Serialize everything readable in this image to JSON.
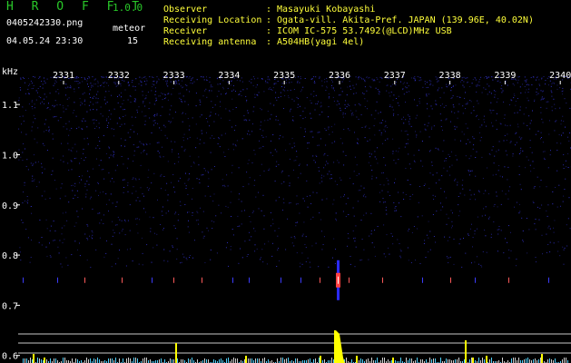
{
  "header": {
    "app_title": "H R O F F T",
    "app_version": "1.0.0",
    "filename": "0405242330.png",
    "datetime": "04.05.24 23:30",
    "meteor_label": "meteor",
    "meteor_count": "15",
    "info": [
      {
        "label": "Observer",
        "sep": ":",
        "value": "Masayuki Kobayashi"
      },
      {
        "label": "Receiving Location",
        "sep": ":",
        "value": "Ogata-vill. Akita-Pref. JAPAN (139.96E, 40.02N)"
      },
      {
        "label": "Receiver",
        "sep": ":",
        "value": "ICOM IC-575 53.7492(@LCD)MHz USB"
      },
      {
        "label": "Receiving antenna",
        "sep": ":",
        "value": "A504HB(yagi 4el)"
      }
    ]
  },
  "chart_data": {
    "type": "heatmap",
    "ylabel": "kHz",
    "x_ticks": [
      "2331",
      "2332",
      "2333",
      "2334",
      "2335",
      "2336",
      "2337",
      "2338",
      "2339",
      "2340"
    ],
    "y_ticks": [
      "1.1",
      "1.0",
      "0.9",
      "0.8",
      "0.7",
      "0.6"
    ],
    "ylim": [
      0.585,
      1.16
    ],
    "signal_band_khz": 0.75,
    "meteor_echo_time": "2336",
    "colors": {
      "background": "#000000",
      "noise": "#2020a0",
      "echo": "#ff4040",
      "histogram": "#ffff00",
      "histogram_low": "#4fd0ff",
      "ref_lines": "#c8c8c8"
    }
  }
}
